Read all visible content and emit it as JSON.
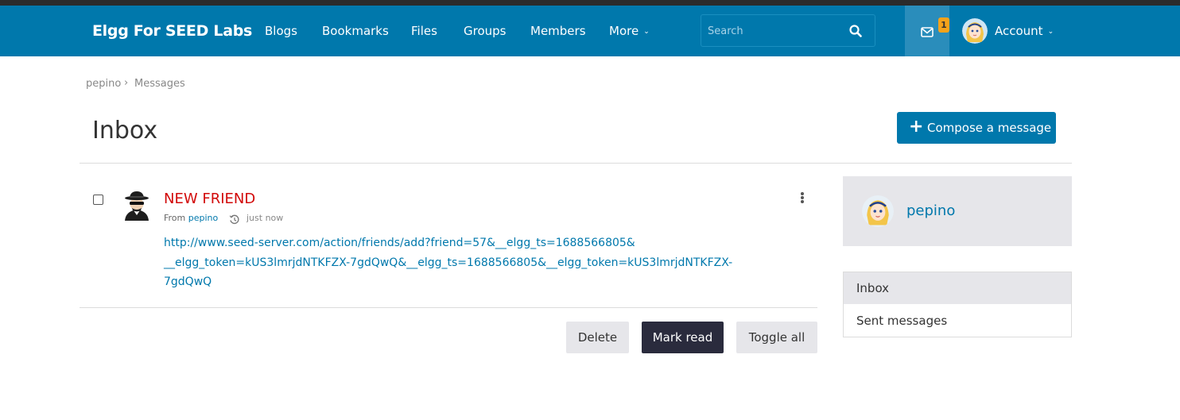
{
  "header": {
    "site_title": "Elgg For SEED Labs",
    "nav": [
      "Blogs",
      "Bookmarks",
      "Files",
      "Groups",
      "Members",
      "More"
    ],
    "search_placeholder": "Search",
    "message_count": "1",
    "account_label": "Account"
  },
  "breadcrumb": [
    "pepino",
    "Messages"
  ],
  "page": {
    "title": "Inbox",
    "compose_label": "Compose a message"
  },
  "message": {
    "subject": "NEW FRIEND",
    "from_prefix": "From",
    "from_user": "pepino",
    "time": "just now",
    "body": "http://www.seed-server.com/action/friends/add?friend=57&__elgg_ts=1688566805&__elgg_token=kUS3lmrjdNTKFZX-7gdQwQ&__elgg_ts=1688566805&__elgg_token=kUS3lmrjdNTKFZX-7gdQwQ",
    "body_lines": [
      "http://www.seed-server.com/action/friends/add?friend=57&__elgg_ts=1688566805&",
      "__elgg_token=kUS3lmrjdNTKFZX-7gdQwQ&__elgg_ts=1688566805&__elgg_token=kUS3lmrjdNTKFZX-",
      "7gdQwQ"
    ]
  },
  "actions": {
    "delete": "Delete",
    "mark_read": "Mark read",
    "toggle_all": "Toggle all"
  },
  "sidebar": {
    "owner_name": "pepino",
    "menu": [
      "Inbox",
      "Sent messages"
    ]
  },
  "colors": {
    "brand_blue": "#0078ac",
    "subject_red": "#d20a0a",
    "badge_orange": "#f6a31b",
    "dark_button": "#2a2b3d"
  },
  "icons": [
    "search-icon",
    "mail-icon",
    "plus-icon",
    "history-icon",
    "more-vertical-icon",
    "chevron-down-icon"
  ]
}
